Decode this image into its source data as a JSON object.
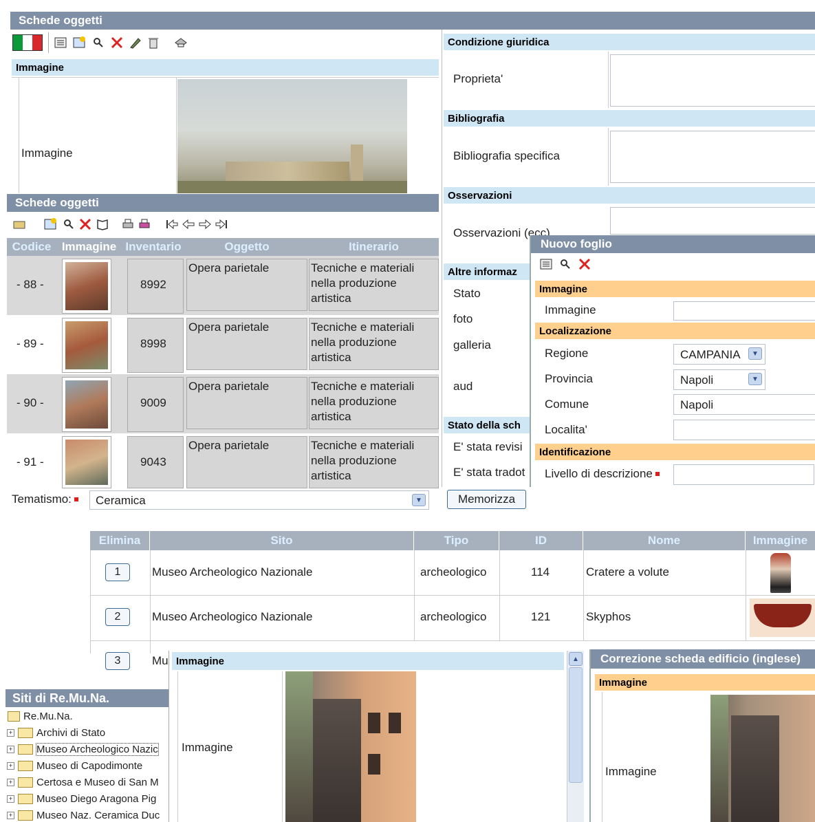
{
  "panel1": {
    "title": "Schede oggetti",
    "section_image": "Immagine",
    "image_label": "Immagine"
  },
  "right_form": {
    "sec_condizione": "Condizione giuridica",
    "proprieta": "Proprieta'",
    "sec_bibliografia": "Bibliografia",
    "bibliografia_specifica": "Bibliografia specifica",
    "sec_osservazioni": "Osservazioni",
    "osservazioni": "Osservazioni (ecc)",
    "sec_altre": "Altre informaz",
    "stato": "Stato",
    "foto": "foto",
    "galleria": "galleria",
    "aud": "aud",
    "sec_stato_scheda": "Stato della sch",
    "revisi": "E' stata revisi",
    "tradot": "E' stata tradot"
  },
  "panel2": {
    "title": "Schede oggetti",
    "columns": [
      "Codice",
      "Immagine",
      "Inventario",
      "Oggetto",
      "Itinerario"
    ],
    "rows": [
      {
        "codice": "- 88 -",
        "inventario": "8992",
        "oggetto": "Opera parietale",
        "itinerario": "Tecniche e materiali nella produzione artistica"
      },
      {
        "codice": "- 89 -",
        "inventario": "8998",
        "oggetto": "Opera parietale",
        "itinerario": "Tecniche e materiali nella produzione artistica"
      },
      {
        "codice": "- 90 -",
        "inventario": "9009",
        "oggetto": "Opera parietale",
        "itinerario": "Tecniche e materiali nella produzione artistica"
      },
      {
        "codice": "- 91 -",
        "inventario": "9043",
        "oggetto": "Opera parietale",
        "itinerario": "Tecniche e materiali nella produzione artistica"
      }
    ]
  },
  "nuovo_foglio": {
    "title": "Nuovo foglio",
    "sec_immagine": "Immagine",
    "immagine": "Immagine",
    "sec_localizzazione": "Localizzazione",
    "regione": "Regione",
    "regione_value": "CAMPANIA",
    "provincia": "Provincia",
    "provincia_value": "Napoli",
    "comune": "Comune",
    "comune_value": "Napoli",
    "localita": "Localita'",
    "sec_identificazione": "Identificazione",
    "livello": "Livello di descrizione"
  },
  "tematismo": {
    "label": "Tematismo:",
    "value": "Ceramica",
    "button": "Memorizza"
  },
  "sites_table": {
    "columns": [
      "Elimina",
      "Sito",
      "Tipo",
      "ID",
      "Nome",
      "Immagine"
    ],
    "rows": [
      {
        "n": "1",
        "sito": "Museo Archeologico Nazionale",
        "tipo": "archeologico",
        "id": "114",
        "nome": "Cratere a volute"
      },
      {
        "n": "2",
        "sito": "Museo Archeologico Nazionale",
        "tipo": "archeologico",
        "id": "121",
        "nome": "Skyphos"
      },
      {
        "n": "3",
        "sito": "Mu"
      }
    ]
  },
  "siti": {
    "title": "Siti di Re.Mu.Na.",
    "root": "Re.Mu.Na.",
    "items": [
      "Archivi di Stato",
      "Museo Archeologico Nazic",
      "Museo di Capodimonte",
      "Certosa e Museo di San M",
      "Museo Diego Aragona Pig",
      "Museo Naz. Ceramica Duc"
    ]
  },
  "immagine_panel": {
    "section": "Immagine",
    "label": "Immagine"
  },
  "correzione": {
    "title": "Correzione scheda edificio (inglese)",
    "section": "Immagine",
    "label": "Immagine"
  }
}
